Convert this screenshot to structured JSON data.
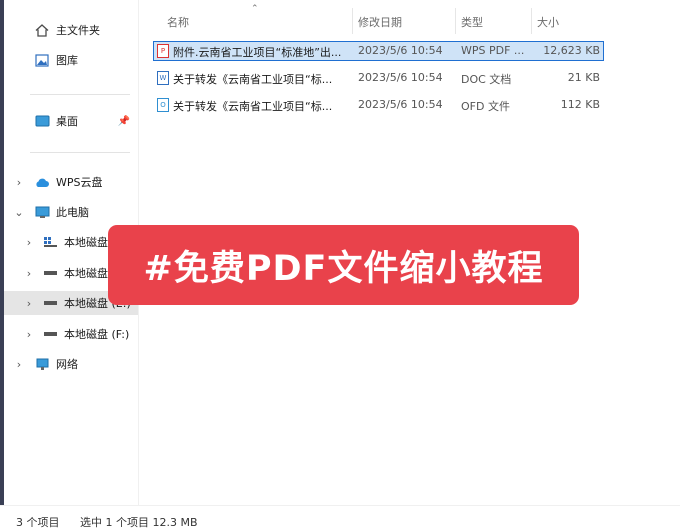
{
  "sidebar": {
    "quick": [
      {
        "label": "主文件夹",
        "icon": "home-icon"
      },
      {
        "label": "图库",
        "icon": "gallery-icon"
      }
    ],
    "pinned": {
      "label": "桌面",
      "icon": "desktop-icon"
    },
    "tree": [
      {
        "label": "WPS云盘",
        "icon": "cloud-icon"
      },
      {
        "label": "此电脑",
        "icon": "computer-icon"
      },
      {
        "label": "本地磁盘",
        "icon": "drive-icon"
      },
      {
        "label": "本地磁盘",
        "icon": "drive-icon"
      },
      {
        "label": "本地磁盘 (E:)",
        "icon": "drive-icon"
      },
      {
        "label": "本地磁盘 (F:)",
        "icon": "drive-icon"
      },
      {
        "label": "网络",
        "icon": "network-icon"
      }
    ]
  },
  "columns": {
    "name": "名称",
    "date": "修改日期",
    "type": "类型",
    "size": "大小"
  },
  "files": [
    {
      "name": "附件.云南省工业项目“标准地”出...",
      "date": "2023/5/6 10:54",
      "type": "WPS PDF ...",
      "size": "12,623 KB",
      "icon": "pdf-file-icon",
      "selected": true
    },
    {
      "name": "关于转发《云南省工业项目“标...",
      "date": "2023/5/6 10:54",
      "type": "DOC 文档",
      "size": "21 KB",
      "icon": "doc-file-icon",
      "selected": false
    },
    {
      "name": "关于转发《云南省工业项目“标...",
      "date": "2023/5/6 10:54",
      "type": "OFD 文件",
      "size": "112 KB",
      "icon": "ofd-file-icon",
      "selected": false
    }
  ],
  "status": {
    "count": "3 个项目",
    "selection": "选中 1 个项目  12.3 MB"
  },
  "banner": "#免费PDF文件缩小教程",
  "colors": {
    "banner": "#e9424b",
    "selection": "#cfe3f7",
    "selection_border": "#1f6fd1"
  }
}
